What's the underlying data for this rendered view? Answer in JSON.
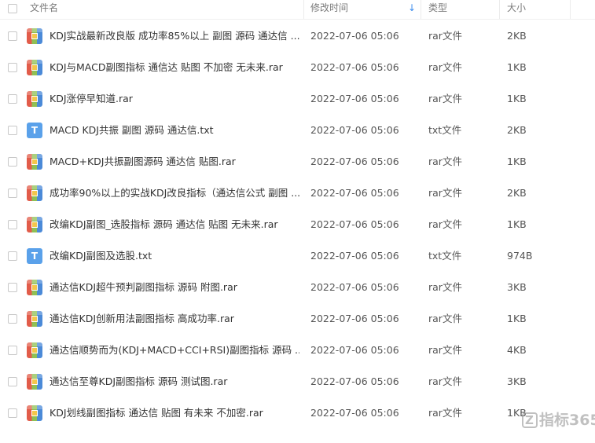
{
  "header": {
    "name_label": "文件名",
    "time_label": "修改时间",
    "type_label": "类型",
    "size_label": "大小",
    "sort_arrow": "↓"
  },
  "rows": [
    {
      "name": "KDJ实战最新改良版 成功率85%以上 副图 源码 通达信 ...",
      "time": "2022-07-06 05:06",
      "type": "rar文件",
      "size": "2KB",
      "icon": "rar-archive-icon"
    },
    {
      "name": "KDJ与MACD副图指标 通信达 贴图 不加密 无未来.rar",
      "time": "2022-07-06 05:06",
      "type": "rar文件",
      "size": "1KB",
      "icon": "rar-archive-icon"
    },
    {
      "name": "KDJ涨停早知道.rar",
      "time": "2022-07-06 05:06",
      "type": "rar文件",
      "size": "1KB",
      "icon": "rar-archive-icon"
    },
    {
      "name": "MACD KDJ共振 副图 源码 通达信.txt",
      "time": "2022-07-06 05:06",
      "type": "txt文件",
      "size": "2KB",
      "icon": "txt-file-icon"
    },
    {
      "name": "MACD+KDJ共振副图源码 通达信 贴图.rar",
      "time": "2022-07-06 05:06",
      "type": "rar文件",
      "size": "1KB",
      "icon": "rar-archive-icon"
    },
    {
      "name": "成功率90%以上的实战KDJ改良指标（通达信公式 副图 ...",
      "time": "2022-07-06 05:06",
      "type": "rar文件",
      "size": "2KB",
      "icon": "rar-archive-icon"
    },
    {
      "name": "改编KDJ副图_选股指标 源码 通达信 贴图 无未来.rar",
      "time": "2022-07-06 05:06",
      "type": "rar文件",
      "size": "1KB",
      "icon": "rar-archive-icon"
    },
    {
      "name": "改编KDJ副图及选股.txt",
      "time": "2022-07-06 05:06",
      "type": "txt文件",
      "size": "974B",
      "icon": "txt-file-icon"
    },
    {
      "name": "通达信KDJ超牛预判副图指标 源码 附图.rar",
      "time": "2022-07-06 05:06",
      "type": "rar文件",
      "size": "3KB",
      "icon": "rar-archive-icon"
    },
    {
      "name": "通达信KDJ创新用法副图指标 高成功率.rar",
      "time": "2022-07-06 05:06",
      "type": "rar文件",
      "size": "1KB",
      "icon": "rar-archive-icon"
    },
    {
      "name": "通达信顺势而为(KDJ+MACD+CCI+RSI)副图指标 源码 ...",
      "time": "2022-07-06 05:06",
      "type": "rar文件",
      "size": "4KB",
      "icon": "rar-archive-icon"
    },
    {
      "name": "通达信至尊KDJ副图指标 源码 测试图.rar",
      "time": "2022-07-06 05:06",
      "type": "rar文件",
      "size": "3KB",
      "icon": "rar-archive-icon"
    },
    {
      "name": "KDJ划线副图指标 通达信 贴图 有未来 不加密.rar",
      "time": "2022-07-06 05:06",
      "type": "rar文件",
      "size": "1KB",
      "icon": "rar-archive-icon"
    }
  ],
  "watermark": {
    "text": "指标365"
  }
}
